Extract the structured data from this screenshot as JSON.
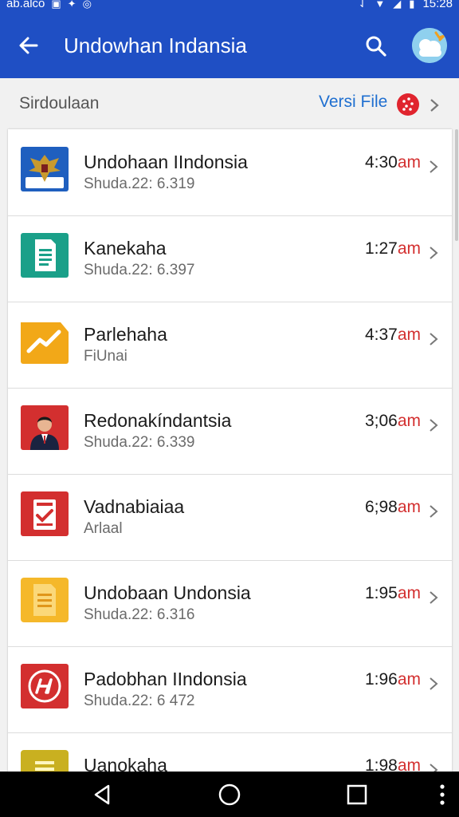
{
  "status_bar": {
    "left_text": "ab.alco",
    "time": "15:28",
    "icons": [
      "notification-icon",
      "signal-icon",
      "wifi-icon",
      "battery-icon"
    ]
  },
  "app_bar": {
    "title": "Undowhan Indansia",
    "icons": [
      "back-arrow-icon",
      "search-icon",
      "avatar-icon"
    ]
  },
  "subheader": {
    "label": "Sirdoulaan",
    "link": "Versi File"
  },
  "items": [
    {
      "title": "Undohaan IIndonsia",
      "subtitle": "Shuda.22: 6.319",
      "time": "4:30",
      "ampm": "am",
      "icon": "garuda-emblem-icon",
      "color": "#1f5fbf"
    },
    {
      "title": "Kanekaha",
      "subtitle": "Shuda.22: 6.397",
      "time": "1:27",
      "ampm": "am",
      "icon": "document-icon",
      "color": "#1aa089"
    },
    {
      "title": "Parlehaha",
      "subtitle": "FiUnai",
      "time": "4:37",
      "ampm": "am",
      "icon": "trend-chart-icon",
      "color": "#f2a818"
    },
    {
      "title": "Redonakíndantsia",
      "subtitle": "Shuda.22: 6.339",
      "time": "3;06",
      "ampm": "am",
      "icon": "person-portrait-icon",
      "color": "#d32f2f"
    },
    {
      "title": "Vadnabiaiaa",
      "subtitle": "Arlaal",
      "time": "6;98",
      "ampm": "am",
      "icon": "checklist-icon",
      "color": "#d32f2f"
    },
    {
      "title": "Undobaan Undonsia",
      "subtitle": "Shuda.22: 6.316",
      "time": "1:95",
      "ampm": "am",
      "icon": "notes-icon",
      "color": "#f5b82a"
    },
    {
      "title": "Padobhan IIndonsia",
      "subtitle": "Shuda.22: 6 472",
      "time": "1:96",
      "ampm": "am",
      "icon": "logo-circle-icon",
      "color": "#d32f2f"
    },
    {
      "title": "Uanokaha",
      "subtitle": "",
      "time": "1:98",
      "ampm": "am",
      "icon": "notes-icon",
      "color": "#c9b020"
    }
  ],
  "nav_bar": {
    "buttons": [
      "back-triangle-icon",
      "home-circle-icon",
      "recents-square-icon",
      "more-vert-icon"
    ]
  },
  "colors": {
    "primary": "#1f4fc4",
    "accent_red": "#d32f2f",
    "link_blue": "#1f6fd0"
  }
}
